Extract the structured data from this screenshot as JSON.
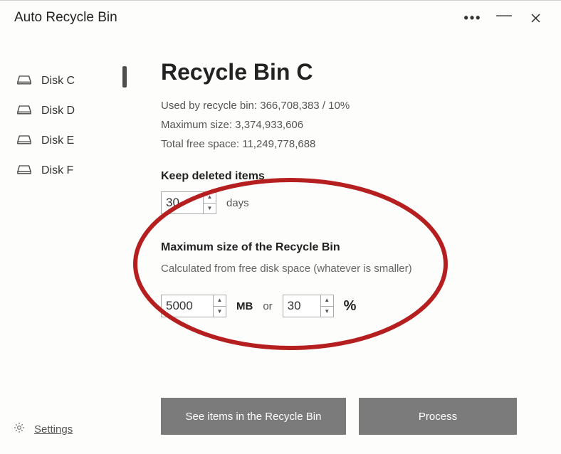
{
  "window": {
    "title": "Auto Recycle Bin"
  },
  "sidebar": {
    "items": [
      {
        "label": "Disk C"
      },
      {
        "label": "Disk D"
      },
      {
        "label": "Disk E"
      },
      {
        "label": "Disk F"
      }
    ],
    "settings_label": "Settings",
    "selected_index": 0
  },
  "main": {
    "title": "Recycle Bin C",
    "stats": {
      "used_label": "Used by recycle bin: 366,708,383 / 10%",
      "max_label": "Maximum size: 3,374,933,606",
      "free_label": "Total free space: 11,249,778,688"
    },
    "keep": {
      "title": "Keep deleted items",
      "value": "30",
      "unit": "days"
    },
    "max": {
      "title": "Maximum size of the Recycle Bin",
      "hint": "Calculated from free disk space (whatever is smaller)",
      "mb_value": "5000",
      "mb_unit": "MB",
      "or_label": "or",
      "pct_value": "30",
      "pct_unit": "%"
    },
    "buttons": {
      "see_items": "See items in the Recycle Bin",
      "process": "Process"
    }
  },
  "annotation": {
    "ellipse_color": "#b51f1f"
  }
}
